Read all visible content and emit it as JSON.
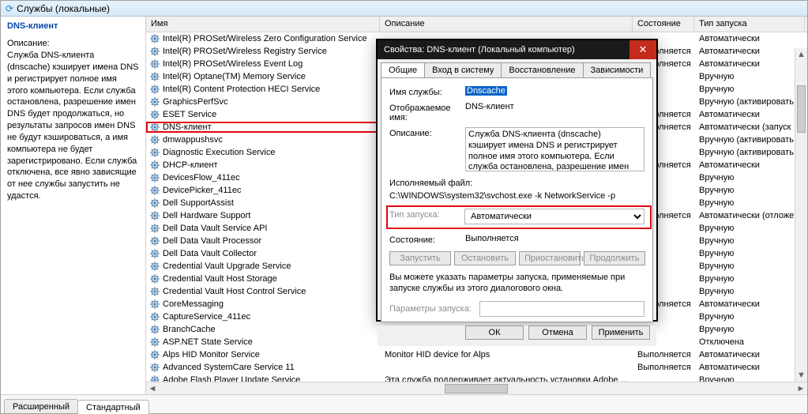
{
  "titlebar": {
    "refresh_glyph": "⟳",
    "title": "Службы (локальные)"
  },
  "left": {
    "name": "DNS-клиент",
    "desc_label": "Описание:",
    "desc": "Служба DNS-клиента (dnscache) кэширует имена DNS и регистрирует полное имя этого компьютера. Если служба остановлена, разрешение имен DNS будет продолжаться, но результаты запросов имен DNS не будут кэшироваться, а имя компьютера не будет зарегистрировано. Если служба отключена, все явно зависящие от нее службы запустить не удастся."
  },
  "columns": {
    "name": "Имя",
    "desc": "Описание",
    "state": "Состояние",
    "start": "Тип запуска"
  },
  "rows": [
    {
      "name": "Intel(R) PROSet/Wireless Zero Configuration Service",
      "state": "",
      "start": "Автоматически"
    },
    {
      "name": "Intel(R) PROSet/Wireless Registry Service",
      "state": "Выполняется",
      "start": "Автоматически"
    },
    {
      "name": "Intel(R) PROSet/Wireless Event Log",
      "state": "Выполняется",
      "start": "Автоматически"
    },
    {
      "name": "Intel(R) Optane(TM) Memory Service",
      "state": "",
      "start": "Вручную"
    },
    {
      "name": "Intel(R) Content Protection HECI Service",
      "state": "",
      "start": "Вручную"
    },
    {
      "name": "GraphicsPerfSvc",
      "state": "",
      "start": "Вручную (активировать з...)"
    },
    {
      "name": "ESET Service",
      "state": "Выполняется",
      "start": "Автоматически"
    },
    {
      "name": "DNS-клиент",
      "state": "Выполняется",
      "start": "Автоматически (запуск п...)",
      "hl": true
    },
    {
      "name": "dmwappushsvc",
      "state": "",
      "start": "Вручную (активировать з...)"
    },
    {
      "name": "Diagnostic Execution Service",
      "state": "",
      "start": "Вручную (активировать з...)"
    },
    {
      "name": "DHCP-клиент",
      "state": "Выполняется",
      "start": "Автоматически"
    },
    {
      "name": "DevicesFlow_411ec",
      "state": "",
      "start": "Вручную"
    },
    {
      "name": "DevicePicker_411ec",
      "state": "",
      "start": "Вручную"
    },
    {
      "name": "Dell SupportAssist",
      "state": "",
      "start": "Вручную"
    },
    {
      "name": "Dell Hardware Support",
      "state": "Выполняется",
      "start": "Автоматически (отложе...)"
    },
    {
      "name": "Dell Data Vault Service API",
      "state": "",
      "start": "Вручную"
    },
    {
      "name": "Dell Data Vault Processor",
      "state": "",
      "start": "Вручную"
    },
    {
      "name": "Dell Data Vault Collector",
      "state": "",
      "start": "Вручную"
    },
    {
      "name": "Credential Vault Upgrade Service",
      "state": "",
      "start": "Вручную"
    },
    {
      "name": "Credential Vault Host Storage",
      "state": "",
      "start": "Вручную"
    },
    {
      "name": "Credential Vault Host Control Service",
      "state": "",
      "start": "Вручную"
    },
    {
      "name": "CoreMessaging",
      "state": "Выполняется",
      "start": "Автоматически"
    },
    {
      "name": "CaptureService_411ec",
      "state": "",
      "start": "Вручную"
    },
    {
      "name": "BranchCache",
      "state": "",
      "start": "Вручную"
    },
    {
      "name": "ASP.NET State Service",
      "state": "",
      "start": "Отключена"
    },
    {
      "name": "Alps HID Monitor Service",
      "desc": "Monitor HID device for Alps",
      "state": "Выполняется",
      "start": "Автоматически"
    },
    {
      "name": "Advanced SystemCare Service 11",
      "state": "Выполняется",
      "start": "Автоматически"
    },
    {
      "name": "Adobe Flash Player Update Service",
      "desc": "Эта служба поддерживает актуальность установки Adobe Flash Playe...",
      "state": "",
      "start": "Вручную"
    }
  ],
  "footer_tabs": {
    "ext": "Расширенный",
    "std": "Стандартный"
  },
  "dialog": {
    "title": "Свойства: DNS-клиент (Локальный компьютер)",
    "tabs": {
      "general": "Общие",
      "logon": "Вход в систему",
      "recovery": "Восстановление",
      "deps": "Зависимости"
    },
    "labels": {
      "svc_name": "Имя службы:",
      "disp_name": "Отображаемое имя:",
      "desc": "Описание:",
      "exe": "Исполняемый файл:",
      "start_type": "Тип запуска:",
      "state": "Состояние:",
      "params": "Параметры запуска:"
    },
    "svc_name": "Dnscache",
    "disp_name": "DNS-клиент",
    "desc": "Служба DNS-клиента (dnscache) кэширует имена DNS и регистрирует полное имя этого компьютера. Если служба остановлена, разрешение имен DNS будет продолжаться, но",
    "exe": "C:\\WINDOWS\\system32\\svchost.exe -k NetworkService -p",
    "start_type": "Автоматически",
    "state": "Выполняется",
    "buttons": {
      "start": "Запустить",
      "stop": "Остановить",
      "pause": "Приостановить",
      "resume": "Продолжить"
    },
    "hint": "Вы можете указать параметры запуска, применяемые при запуске службы из этого диалогового окна.",
    "footer": {
      "ok": "ОК",
      "cancel": "Отмена",
      "apply": "Применить"
    }
  }
}
